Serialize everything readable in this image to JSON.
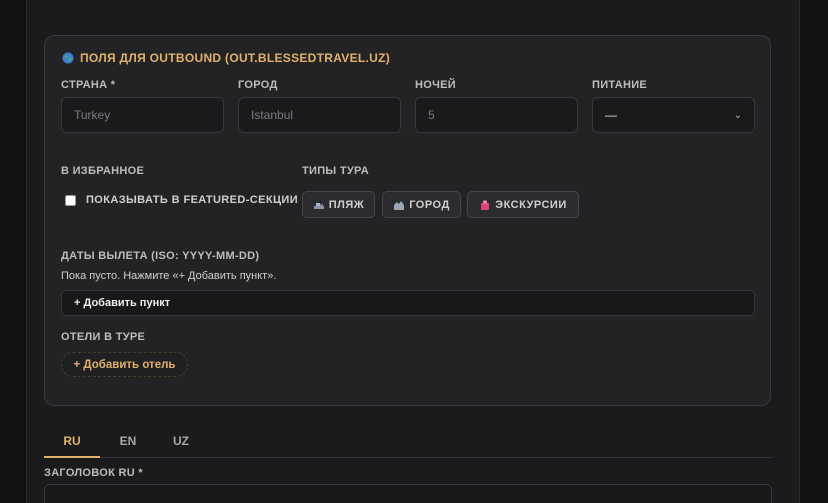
{
  "section": {
    "title": "ПОЛЯ ДЛЯ OUTBOUND (OUT.BLESSEDTRAVEL.UZ)",
    "icon": "globe-icon"
  },
  "fields": {
    "country": {
      "label": "СТРАНА *",
      "placeholder": "Turkey"
    },
    "city": {
      "label": "ГОРОД",
      "placeholder": "Istanbul"
    },
    "nights": {
      "label": "НОЧЕЙ",
      "placeholder": "5"
    },
    "meal": {
      "label": "ПИТАНИЕ",
      "value": "—"
    }
  },
  "featured": {
    "label": "В ИЗБРАННОЕ",
    "checkbox_label": "ПОКАЗЫВАТЬ В FEATURED-СЕКЦИИ",
    "checked": false
  },
  "tour_types": {
    "label": "ТИПЫ ТУРА",
    "items": [
      {
        "label": "ПЛЯЖ",
        "icon": "beach-icon"
      },
      {
        "label": "ГОРОД",
        "icon": "city-icon"
      },
      {
        "label": "ЭКСКУРСИИ",
        "icon": "excursion-icon"
      }
    ]
  },
  "departure_dates": {
    "label": "ДАТЫ ВЫЛЕТА (ISO: YYYY-MM-DD)",
    "empty_hint": "Пока пусто. Нажмите «+ Добавить пункт».",
    "add_label": "+ Добавить пункт"
  },
  "hotels": {
    "label": "ОТЕЛИ В ТУРЕ",
    "add_label": "+ Добавить отель"
  },
  "lang_tabs": [
    {
      "label": "RU",
      "active": true
    },
    {
      "label": "EN",
      "active": false
    },
    {
      "label": "UZ",
      "active": false
    }
  ],
  "title_field": {
    "label": "ЗАГОЛОВОК RU *"
  },
  "colors": {
    "accent": "#e0b16b",
    "card_bg": "#232326",
    "page_bg": "#121214"
  }
}
